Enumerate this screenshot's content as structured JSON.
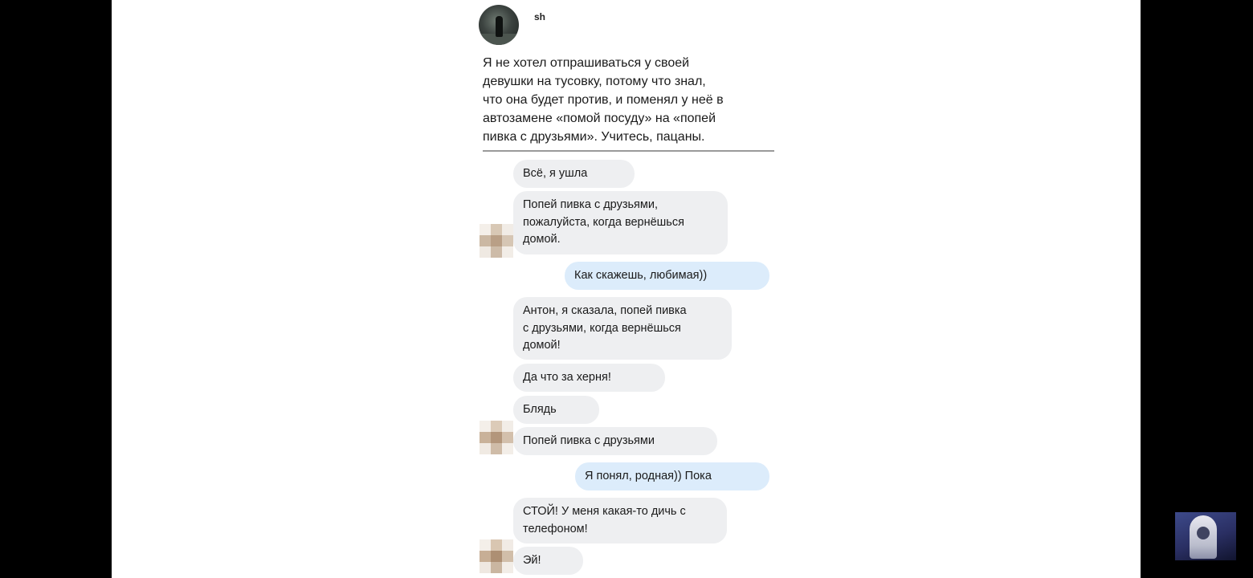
{
  "post": {
    "username": "sh",
    "text": "Я не хотел отпрашиваться у своей\nдевушки на тусовку, потому что знал,\nчто она будет против, и поменял у неё в\nавтозамене «помой посуду» на «попей\nпивка с друзьями». Учитесь, пацаны."
  },
  "messages": [
    {
      "text": "Всё, я ушла"
    },
    {
      "text": "Попей пивка с друзьями,\nпожалуйста, когда вернёшься\nдомой."
    },
    {
      "text": "Как скажешь, любимая))"
    },
    {
      "text": "Антон, я сказала, попей пивка\nс друзьями, когда вернёшься\nдомой!"
    },
    {
      "text": "Да что за херня!"
    },
    {
      "text": "Блядь"
    },
    {
      "text": "Попей пивка с друзьями"
    },
    {
      "text": "Я понял, родная)) Пока"
    },
    {
      "text": "СТОЙ! У меня какая-то дичь с\nтелефоном!"
    },
    {
      "text": "Эй!"
    }
  ],
  "colors": {
    "incoming_bubble": "#eeeff1",
    "outgoing_bubble": "#dcecfb",
    "background": "#ffffff",
    "letterbox": "#000000"
  },
  "icons": {
    "avatar": "user-avatar",
    "blurred_avatar": "pixelated-avatar-icon",
    "thumbnail": "channel-watermark-thumbnail"
  }
}
